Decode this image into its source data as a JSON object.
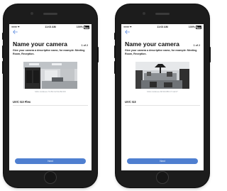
{
  "phones": [
    {
      "status": {
        "time": "11:03 AM",
        "battery": "100%"
      },
      "back_icon": "back-arrow-icon",
      "title": "Name your camera",
      "step": "1 of 2",
      "description": "Give your camera a descriptive name, for example: Meeting Room, Reception.",
      "mac": "MAC Address 74:83:C2:6A:B4:FD",
      "camera_name": "UVC G3 Flex",
      "next_label": "Next"
    },
    {
      "status": {
        "time": "11:03 AM",
        "battery": "100%"
      },
      "back_icon": "back-arrow-icon",
      "title": "Name your camera",
      "step": "1 of 2",
      "description": "Give your camera a descriptive name, for example: Meeting Room, Reception.",
      "mac": "MAC Address 68:D4:8B:C7:1E:07",
      "camera_name": "UVC G3",
      "next_label": "Next"
    }
  ],
  "colors": {
    "accent": "#4f7fd0",
    "back": "#5b8be0",
    "phone_body": "#1c1c1c"
  }
}
